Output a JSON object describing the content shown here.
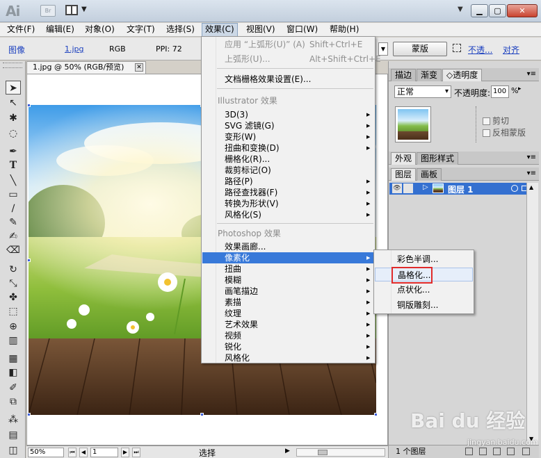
{
  "titlebar": {
    "logo": "Ai",
    "bridge": "Br"
  },
  "menubar": {
    "items": [
      "文件(F)",
      "编辑(E)",
      "对象(O)",
      "文字(T)",
      "选择(S)",
      "效果(C)",
      "视图(V)",
      "窗口(W)",
      "帮助(H)"
    ]
  },
  "controlbar": {
    "image_label": "图像",
    "filename": "1.jpg",
    "color_mode": "RGB",
    "ppi": "PPI: 72",
    "mask_button": "蒙版",
    "opacity_link": "不透...",
    "align_link": "对齐"
  },
  "document": {
    "tab_title": "1.jpg @ 50% (RGB/预览)",
    "close": "✕"
  },
  "statusbar": {
    "zoom": "50%",
    "page": "1",
    "tool": "选择"
  },
  "effect_menu": {
    "apply_last": {
      "label": "应用 “上弧形(U)” (A)",
      "shortcut": "Shift+Ctrl+E"
    },
    "last": {
      "label": "上弧形(U)...",
      "shortcut": "Alt+Shift+Ctrl+E"
    },
    "raster_settings": "文档栅格效果设置(E)...",
    "illustrator_header": "Illustrator 效果",
    "illustrator_items": [
      "3D(3)",
      "SVG 滤镜(G)",
      "变形(W)",
      "扭曲和变换(D)",
      "栅格化(R)...",
      "裁剪标记(O)",
      "路径(P)",
      "路径查找器(F)",
      "转换为形状(V)",
      "风格化(S)"
    ],
    "photoshop_header": "Photoshop 效果",
    "photoshop_items": [
      "效果画廊...",
      "像素化",
      "扭曲",
      "模糊",
      "画笔描边",
      "素描",
      "纹理",
      "艺术效果",
      "视频",
      "锐化",
      "风格化"
    ]
  },
  "pixelate_submenu": {
    "items": [
      "彩色半调...",
      "晶格化...",
      "点状化...",
      "铜版雕刻..."
    ]
  },
  "panels": {
    "top_tabs": [
      "描边",
      "渐变",
      "◇透明度"
    ],
    "blend_mode": "正常",
    "opacity_label": "不透明度:",
    "opacity_value": "100",
    "opacity_unit": "%",
    "clip_label": "剪切",
    "invert_label": "反相蒙版",
    "mid_tabs": [
      "外观",
      "图形样式"
    ],
    "layer_tabs": [
      "图层",
      "画板"
    ],
    "layer_name": "图层 1",
    "layer_count": "1 个图层"
  },
  "watermark": {
    "main": "Bai du 经验",
    "sub": "jingyan.baidu.com"
  }
}
